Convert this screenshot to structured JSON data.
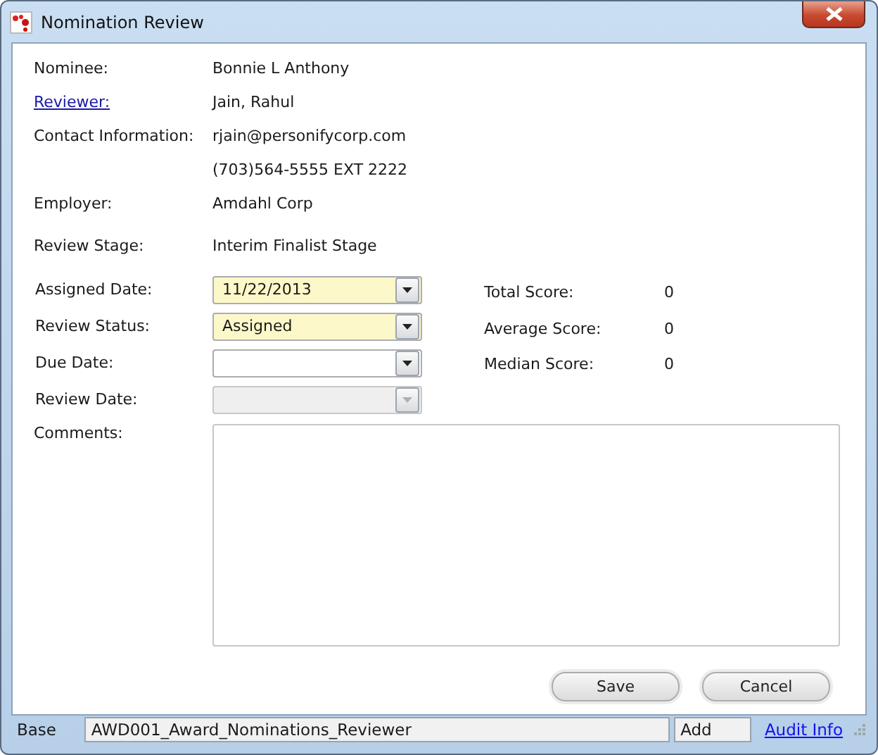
{
  "window": {
    "title": "Nomination Review"
  },
  "info": [
    {
      "label": "Nominee:",
      "kind": "text",
      "values": [
        "Bonnie L Anthony"
      ]
    },
    {
      "label": "Reviewer:",
      "kind": "link",
      "values": [
        "Jain, Rahul"
      ]
    },
    {
      "label": "Contact Information:",
      "kind": "text",
      "values": [
        "rjain@personifycorp.com",
        "(703)564-5555 EXT 2222"
      ]
    },
    {
      "label": "Employer:",
      "kind": "text",
      "values": [
        "Amdahl Corp"
      ]
    },
    {
      "label": "Review Stage:",
      "kind": "text",
      "values": [
        "Interim Finalist Stage"
      ]
    }
  ],
  "dropdowns": [
    {
      "label": "Assigned Date:",
      "value": "11/22/2013",
      "required": true,
      "disabled": false
    },
    {
      "label": "Review Status:",
      "value": "Assigned",
      "required": true,
      "disabled": false
    },
    {
      "label": "Due Date:",
      "required": false,
      "disabled": false
    },
    {
      "label": "Review Date:",
      "required": false,
      "disabled": true
    }
  ],
  "scores": [
    {
      "label": "Total Score:",
      "value": "0"
    },
    {
      "label": "Average Score:",
      "value": "0"
    },
    {
      "label": "Median Score:",
      "value": "0"
    }
  ],
  "comments": {
    "label": "Comments:"
  },
  "buttons": [
    "Save",
    "Cancel"
  ],
  "status_bar": {
    "mode": "Base",
    "form": "AWD001_Award_Nominations_Reviewer",
    "action": "Add",
    "link": "Audit Info"
  }
}
